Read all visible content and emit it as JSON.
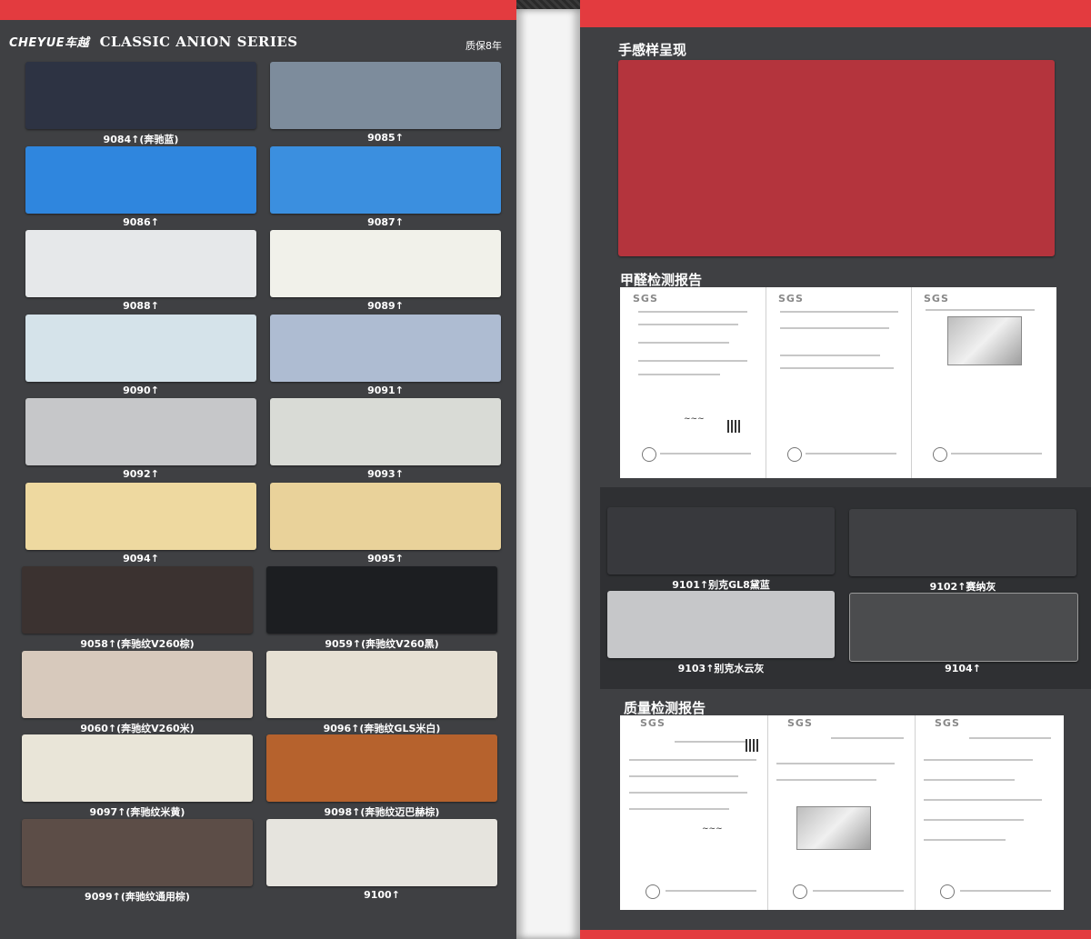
{
  "header": {
    "brand": "CHEYUE车越",
    "series": "CLASSIC ANION SERIES",
    "warranty": "质保8年"
  },
  "left_swatches": [
    {
      "code": "9084↑(奔驰蓝)",
      "color": "#2d3343"
    },
    {
      "code": "9085↑",
      "color": "#7d8c9c"
    },
    {
      "code": "9086↑",
      "color": "#2f86de"
    },
    {
      "code": "9087↑",
      "color": "#3b8fdf"
    },
    {
      "code": "9088↑",
      "color": "#e6e8ea"
    },
    {
      "code": "9089↑",
      "color": "#f1f1ea"
    },
    {
      "code": "9090↑",
      "color": "#d5e3ea"
    },
    {
      "code": "9091↑",
      "color": "#aebcd2"
    },
    {
      "code": "9092↑",
      "color": "#c6c7c9"
    },
    {
      "code": "9093↑",
      "color": "#d9dbd6"
    },
    {
      "code": "9094↑",
      "color": "#eed9a0"
    },
    {
      "code": "9095↑",
      "color": "#e9d29a"
    },
    {
      "code": "9058↑(奔驰纹V260棕)",
      "color": "#3b3230"
    },
    {
      "code": "9059↑(奔驰纹V260黑)",
      "color": "#1c1e21"
    },
    {
      "code": "9060↑(奔驰纹V260米)",
      "color": "#d7c9bc"
    },
    {
      "code": "9096↑(奔驰纹GLS米白)",
      "color": "#e6e0d3"
    },
    {
      "code": "9097↑(奔驰纹米黄)",
      "color": "#e9e5d8"
    },
    {
      "code": "9098↑(奔驰纹迈巴赫棕)",
      "color": "#b6622d"
    },
    {
      "code": "9099↑(奔驰纹通用棕)",
      "color": "#5c4d47"
    },
    {
      "code": "9100↑",
      "color": "#e6e4de"
    }
  ],
  "right": {
    "touch_title": "手感样呈现",
    "touch_color": "#b4343d",
    "formaldehyde_title": "甲醛检测报告",
    "quality_title": "质量检测报告",
    "sgs_label": "SGS",
    "swatches": [
      {
        "code": "9101↑别克GL8黛蓝",
        "color": "#38393d"
      },
      {
        "code": "9102↑赛纳灰",
        "color": "#3f4043"
      },
      {
        "code": "9103↑别克水云灰",
        "color": "#c6c7c9"
      },
      {
        "code": "9104↑",
        "color": "#4b4c4e"
      }
    ]
  }
}
